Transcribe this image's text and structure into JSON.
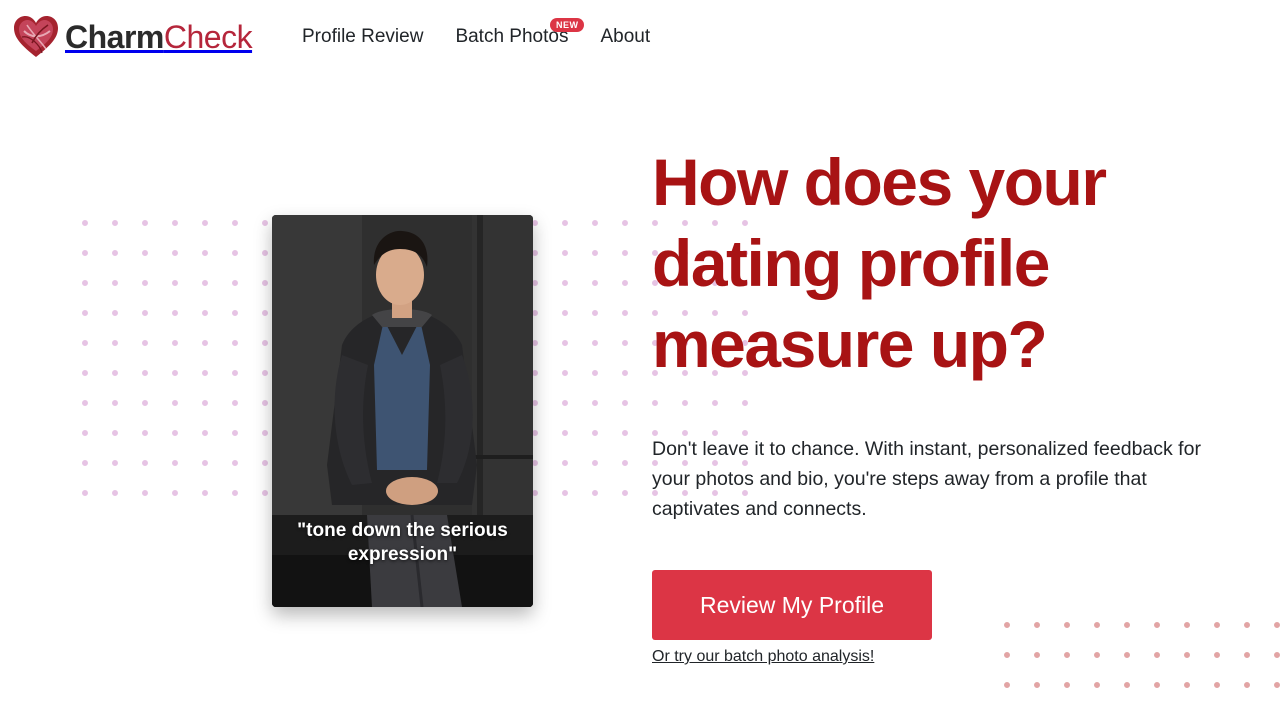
{
  "brand": {
    "name_part1": "Charm",
    "name_part2": "Check",
    "logo_icon": "heart-logo-icon"
  },
  "nav": {
    "links": [
      {
        "label": "Profile Review"
      },
      {
        "label": "Batch Photos",
        "badge": "NEW"
      },
      {
        "label": "About"
      }
    ]
  },
  "hero": {
    "title": "How does your dating profile measure up?",
    "subtitle": "Don't leave it to chance. With instant, personalized feedback for your photos and bio, you're steps away from a profile that captivates and connects.",
    "cta_label": "Review My Profile",
    "alt_link_label": "Or try our batch photo analysis!"
  },
  "photo": {
    "caption": "\"tone down the serious expression\""
  },
  "colors": {
    "brand_red": "#a81314",
    "button_red": "#dc3545",
    "dots_pink": "#e6c3e4",
    "dots_red": "#e2a4a4"
  }
}
